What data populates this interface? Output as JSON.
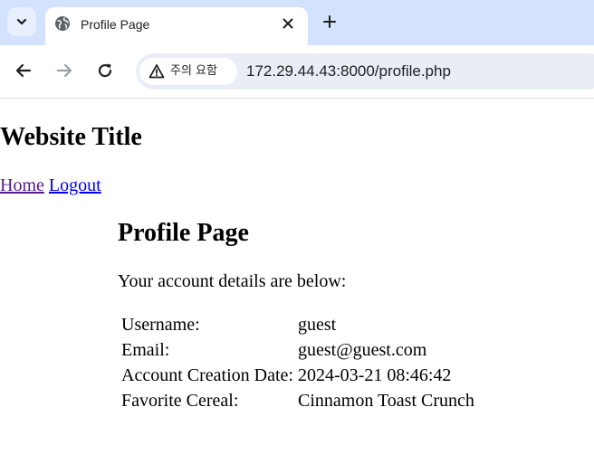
{
  "browser": {
    "tab": {
      "title": "Profile Page"
    },
    "security": {
      "label": "주의 요함"
    },
    "url": "172.29.44.43:8000/profile.php"
  },
  "site": {
    "title": "Website Title",
    "nav": {
      "home": "Home",
      "logout": "Logout"
    }
  },
  "profile": {
    "heading": "Profile Page",
    "intro": "Your account details are below:",
    "rows": [
      {
        "label": "Username:",
        "value": "guest"
      },
      {
        "label": "Email:",
        "value": "guest@guest.com"
      },
      {
        "label": "Account Creation Date:",
        "value": "2024-03-21 08:46:42"
      },
      {
        "label": "Favorite Cereal:",
        "value": "Cinnamon Toast Crunch"
      }
    ]
  },
  "icons": {
    "tab_list": "chevron-down-icon",
    "favicon": "globe-icon",
    "tab_close": "close-icon",
    "new_tab": "plus-icon",
    "back": "back-arrow-icon",
    "forward": "forward-arrow-icon",
    "reload": "reload-icon",
    "security": "warning-icon"
  },
  "colors": {
    "tabstrip": "#d3e3fd",
    "omnibox": "#e9eef6",
    "visited_link": "#551a8b",
    "link": "#0000ee"
  }
}
